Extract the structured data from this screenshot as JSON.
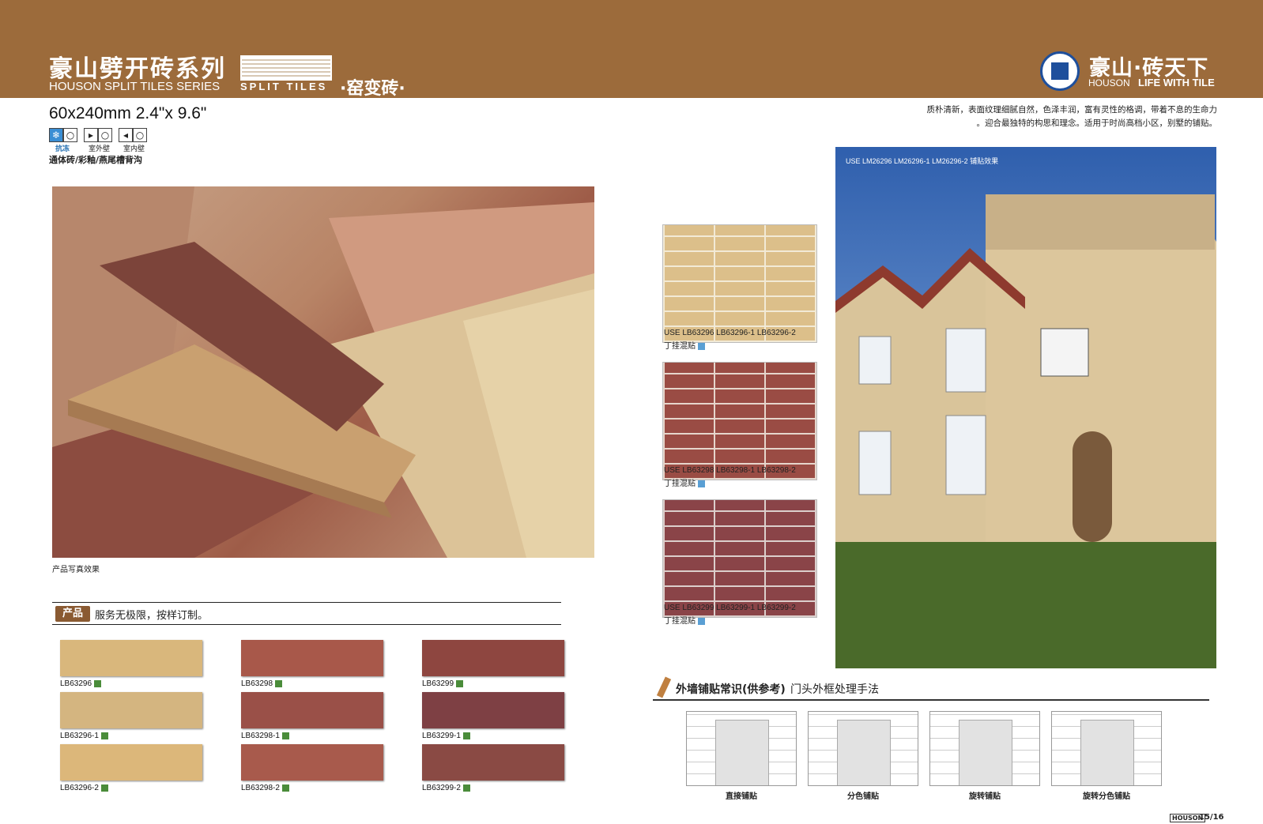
{
  "header": {
    "series_cn": "豪山劈开砖系列",
    "series_en": "HOUSON SPLIT TILES SERIES",
    "split_tiles": "SPLIT TILES",
    "kiln": "·窑变砖·",
    "brand_cn": "豪山·砖天下",
    "brand_en_left": "HOUSON",
    "brand_en_right": "LIFE WITH TILE"
  },
  "specs": {
    "size": "60x240mm 2.4\"x 9.6\"",
    "icon_captions": [
      "抗冻",
      "室外壁",
      "室内壁"
    ],
    "body_note": "通体砖/彩釉/燕尾槽背沟"
  },
  "description": {
    "line1": "质朴清新，表面纹理细腻自然，色泽丰润，富有灵性的格调，带着不息的生命力",
    "line2": "。迎合最独特的构思和理念。适用于时尚高档小区，别墅的铺贴。"
  },
  "main_photo": {
    "caption": "产品写真效果"
  },
  "product_bar": {
    "tag": "产品",
    "text": "服务无极限，按样订制。"
  },
  "swatches": [
    {
      "code": "LB63296",
      "color": "#d9b77c"
    },
    {
      "code": "LB63298",
      "color": "#a8584a"
    },
    {
      "code": "LB63299",
      "color": "#8e4640"
    },
    {
      "code": "LB63296-1",
      "color": "#d4b580"
    },
    {
      "code": "LB63298-1",
      "color": "#9a5048"
    },
    {
      "code": "LB63299-1",
      "color": "#7e4044"
    },
    {
      "code": "LB63296-2",
      "color": "#dcb77a"
    },
    {
      "code": "LB63298-2",
      "color": "#a85a4c"
    },
    {
      "code": "LB63299-2",
      "color": "#8a4a44"
    }
  ],
  "brick_panels": [
    {
      "use": "USE LB63296  LB63296-1  LB63296-2",
      "mix": "丁挂混贴",
      "color": "#dcbf8a",
      "mortar": "#f2ead6"
    },
    {
      "use": "USE LB63298  LB63298-1  LB63298-2",
      "mix": "丁挂混贴",
      "color": "#9a4c44",
      "mortar": "#e6d6cc"
    },
    {
      "use": "USE LB63299  LB63299-1  LB63299-2",
      "mix": "丁挂混贴",
      "color": "#8a4448",
      "mortar": "#dccfcc"
    }
  ],
  "house": {
    "caption": "USE  LM26296  LM26296-1  LM26296-2  铺贴效果"
  },
  "wall_knowledge": {
    "title": "外墙铺贴常识(供参考)",
    "subtitle": "门头外框处理手法",
    "methods": [
      "直接铺贴",
      "分色铺贴",
      "旋转铺贴",
      "旋转分色铺贴"
    ]
  },
  "footer": {
    "brand": "HOUSON",
    "page": "15/16"
  }
}
